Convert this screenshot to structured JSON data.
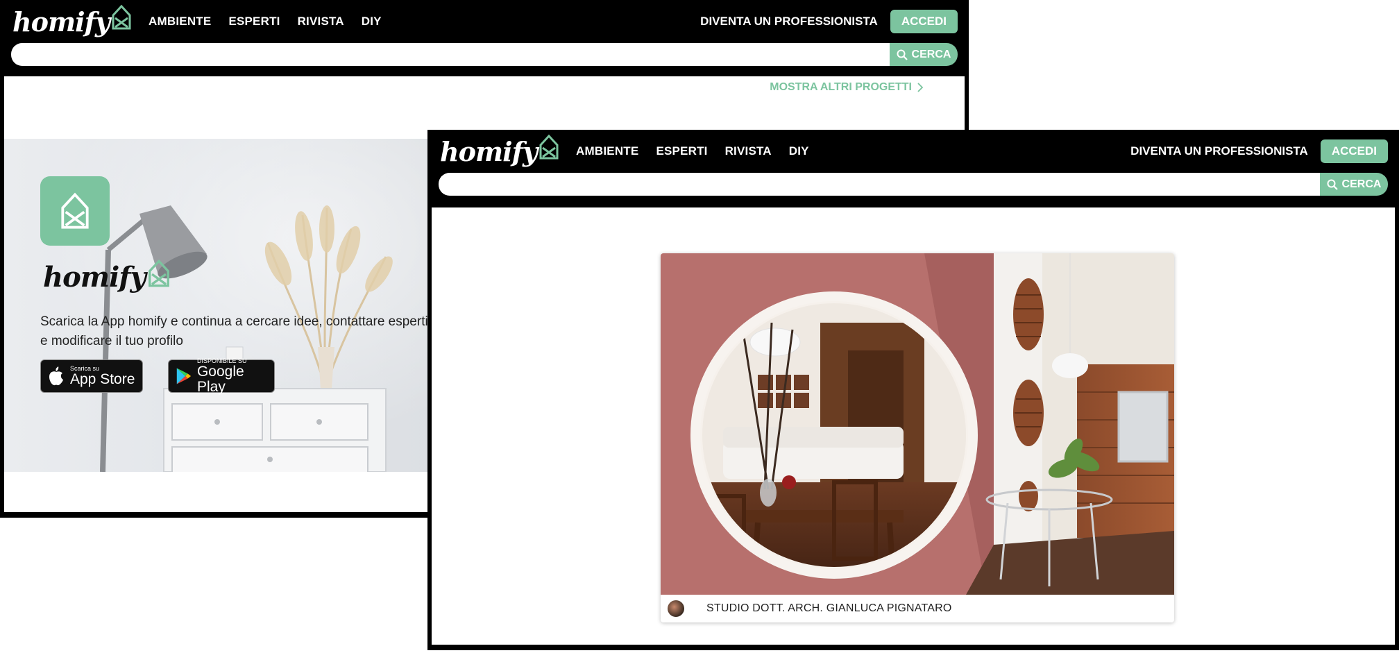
{
  "brand": {
    "logo_text": "homify"
  },
  "nav": {
    "links": [
      "AMBIENTE",
      "ESPERTI",
      "RIVISTA",
      "DIY"
    ],
    "pro_link": "DIVENTA UN PROFESSIONISTA",
    "login": "ACCEDI"
  },
  "search": {
    "button_label": "CERCA",
    "placeholder": ""
  },
  "back_page": {
    "more_projects": "MOSTRA ALTRI PROGETTI",
    "app_banner": {
      "logo_text": "homify",
      "description_line1": "Scarica la App homify e continua a cercare idee, contattare esperti",
      "description_line2": "e modificare il tuo profilo",
      "appstore_small": "Scarica su",
      "appstore_big": "App Store",
      "googleplay_small": "DISPONIBILE SU",
      "googleplay_big": "Google Play"
    }
  },
  "front_page": {
    "project_card": {
      "professional_name": "STUDIO DOTT. ARCH. GIANLUCA PIGNATARO"
    }
  },
  "colors": {
    "accent": "#7cc49f",
    "nav_bg": "#000000",
    "wall_pink": "#b7706d"
  },
  "icons": [
    "homify-house-icon",
    "search-icon",
    "chevron-right-icon",
    "apple-icon",
    "google-play-icon"
  ]
}
